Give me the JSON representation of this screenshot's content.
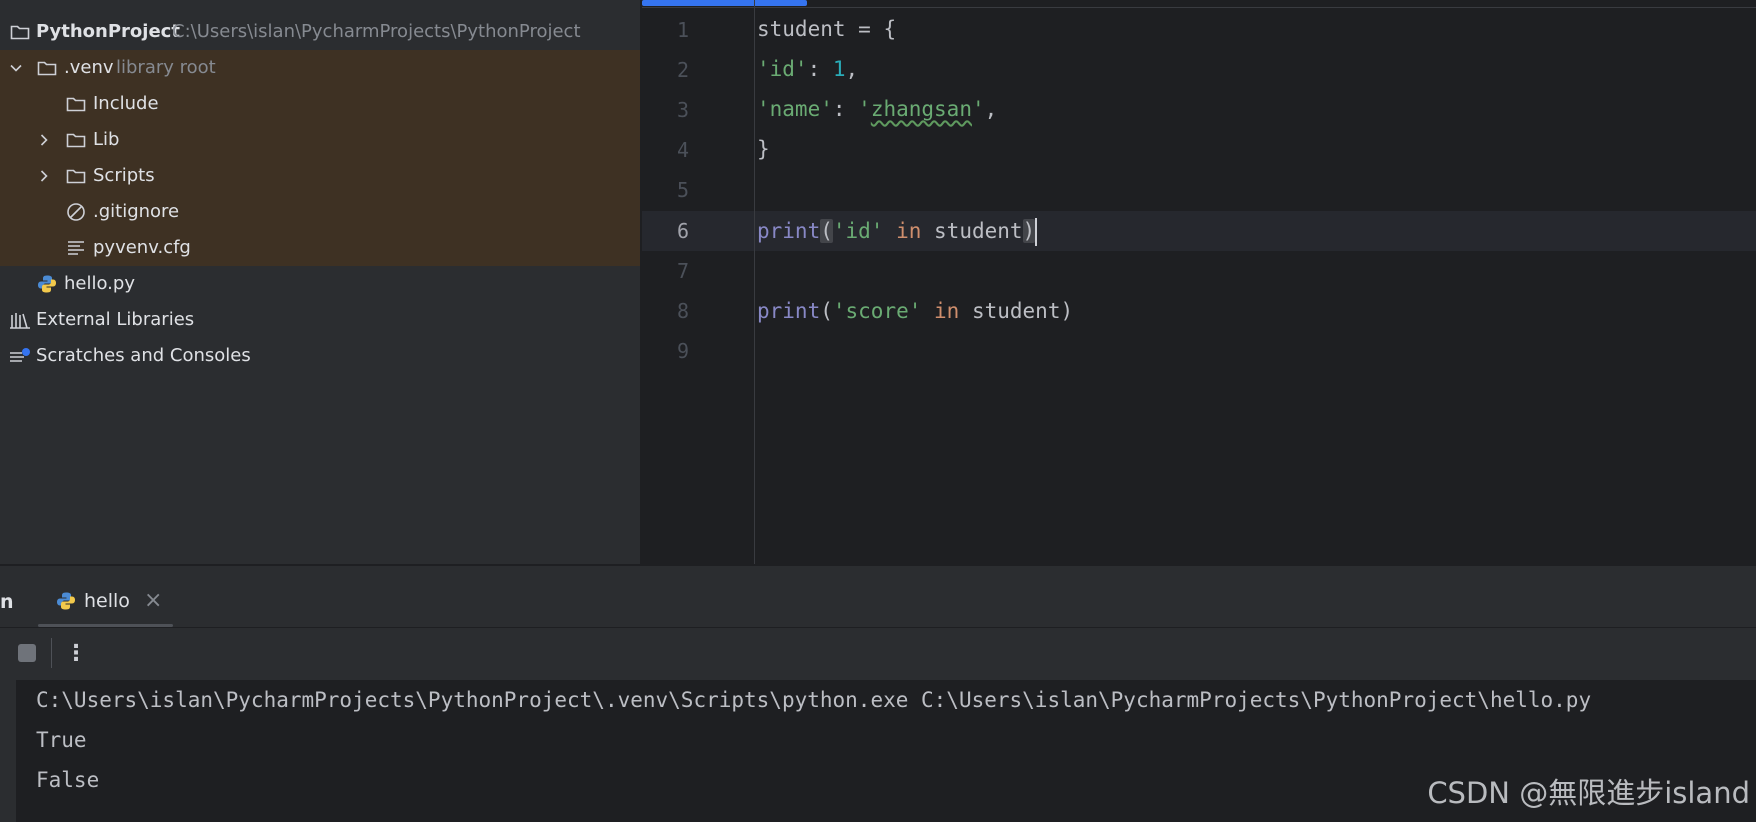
{
  "project_tree": {
    "root": {
      "name": "PythonProject",
      "path": "C:\\Users\\islan\\PycharmProjects\\PythonProject",
      "icon": "folder-icon"
    },
    "venv": {
      "name": ".venv",
      "hint": "library root",
      "icon": "folder-icon",
      "expanded": true
    },
    "venv_children": [
      {
        "name": "Include",
        "icon": "folder-icon",
        "expandable": false
      },
      {
        "name": "Lib",
        "icon": "folder-icon",
        "expandable": true
      },
      {
        "name": "Scripts",
        "icon": "folder-icon",
        "expandable": true
      },
      {
        "name": ".gitignore",
        "icon": "ignore-file-icon",
        "expandable": false
      },
      {
        "name": "pyvenv.cfg",
        "icon": "config-file-icon",
        "expandable": false
      }
    ],
    "hello_file": {
      "name": "hello.py",
      "icon": "python-file-icon"
    },
    "external_libraries": {
      "name": "External Libraries",
      "icon": "libraries-icon"
    },
    "scratches": {
      "name": "Scratches and Consoles",
      "icon": "scratches-icon"
    }
  },
  "editor": {
    "line_numbers": [
      "1",
      "2",
      "3",
      "4",
      "5",
      "6",
      "7",
      "8",
      "9"
    ],
    "active_line": "6",
    "code": {
      "l1_var": "student",
      "l1_rest": " = {",
      "l2_key": "'id'",
      "l2_colon": ": ",
      "l2_val": "1",
      "l2_comma": ",",
      "l3_key": "'name'",
      "l3_colon": ": ",
      "l3_q1": "'",
      "l3_val": "zhangsan",
      "l3_q2": "'",
      "l3_comma": ",",
      "l4": "}",
      "l6_fn": "print",
      "l6_open": "(",
      "l6_str": "'id'",
      "l6_kw": " in",
      "l6_var": " student",
      "l6_close": ")",
      "l8_fn": "print",
      "l8_open": "(",
      "l8_str": "'score'",
      "l8_kw": " in",
      "l8_var": " student",
      "l8_close": ")"
    }
  },
  "run_panel": {
    "title_fragment": "n",
    "tab_label": "hello",
    "tab_close": "×",
    "more_glyph": "⋮",
    "console_lines": [
      "C:\\Users\\islan\\PycharmProjects\\PythonProject\\.venv\\Scripts\\python.exe C:\\Users\\islan\\PycharmProjects\\PythonProject\\hello.py",
      "True",
      "False"
    ]
  },
  "watermark": "CSDN @無限進步island",
  "colors": {
    "accent": "#3574f0",
    "venv_highlight": "#3e3123",
    "string": "#6aab73",
    "number": "#2aacb8",
    "keyword": "#cf8e6d",
    "builtin": "#8888c6"
  }
}
